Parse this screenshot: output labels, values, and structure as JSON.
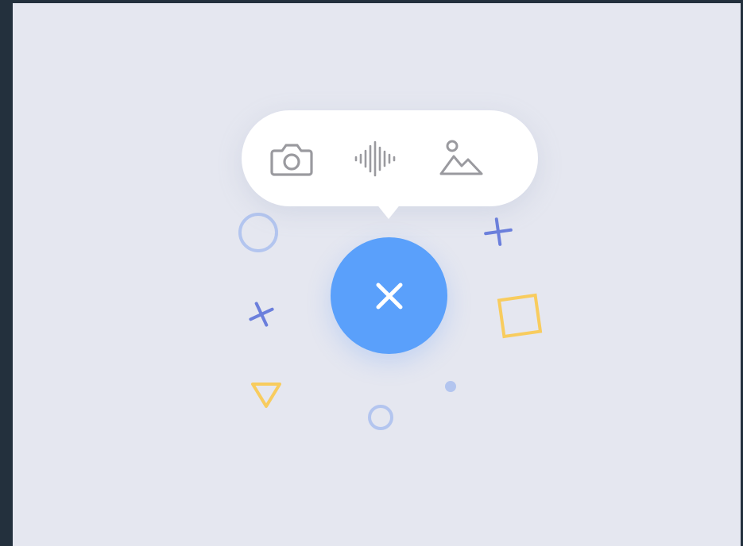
{
  "colors": {
    "frame_background": "#23303d",
    "canvas_background": "#e5e7f0",
    "popover_background": "#ffffff",
    "icon_gray": "#9a9a9f",
    "fab_blue": "#5aa0fb",
    "fab_icon": "#ffffff",
    "deco_light_blue": "#b3c5ef",
    "deco_indigo": "#6b7fdc",
    "deco_yellow": "#f8cc5e"
  },
  "popover": {
    "actions": [
      {
        "icon": "camera-icon"
      },
      {
        "icon": "audio-waveform-icon"
      },
      {
        "icon": "image-icon"
      }
    ]
  },
  "fab": {
    "state": "open",
    "icon": "close-icon"
  }
}
